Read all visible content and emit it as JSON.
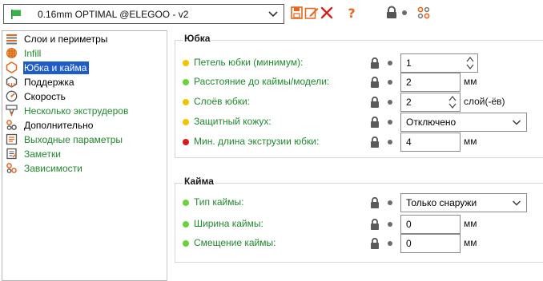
{
  "colors": {
    "accent_green": "#1f8a2c",
    "selection_blue": "#1e5cc8",
    "bullet_yellow": "#f2c400",
    "bullet_green": "#6ad33b",
    "bullet_red": "#d81b1b",
    "toolbar_orange": "#e8651a",
    "toolbar_red": "#d62020"
  },
  "preset": {
    "name": "0.16mm OPTIMAL @ELEGOO - v2",
    "flag_icon": "flag-icon",
    "chevron_icon": "chevron-down-icon"
  },
  "toolbar": {
    "icons": [
      "save-icon",
      "edit-icon",
      "delete-icon",
      "help-icon",
      "lock-icon",
      "dot",
      "compare-icon"
    ]
  },
  "sidebar": {
    "items": [
      {
        "label": "Слои и периметры",
        "icon": "layers-icon",
        "green": false,
        "selected": false
      },
      {
        "label": "Infill",
        "icon": "infill-icon",
        "green": true,
        "selected": false
      },
      {
        "label": "Юбка и кайма",
        "icon": "skirt-icon",
        "green": false,
        "selected": true
      },
      {
        "label": "Поддержка",
        "icon": "support-icon",
        "green": false,
        "selected": false
      },
      {
        "label": "Скорость",
        "icon": "speed-icon",
        "green": false,
        "selected": false
      },
      {
        "label": "Несколько экструдеров",
        "icon": "extruders-icon",
        "green": true,
        "selected": false
      },
      {
        "label": "Дополнительно",
        "icon": "advanced-icon",
        "green": false,
        "selected": false
      },
      {
        "label": "Выходные параметры",
        "icon": "output-icon",
        "green": true,
        "selected": false
      },
      {
        "label": "Заметки",
        "icon": "notes-icon",
        "green": true,
        "selected": false
      },
      {
        "label": "Зависимости",
        "icon": "dependencies-icon",
        "green": true,
        "selected": false
      }
    ]
  },
  "skirt": {
    "title": "Юбка",
    "options": [
      {
        "label": "Петель юбки (минимум):",
        "bullet": "yellow",
        "value": "1",
        "control": "spin",
        "unit": ""
      },
      {
        "label": "Расстояние до каймы/модели:",
        "bullet": "green",
        "value": "2",
        "control": "text",
        "unit": "мм"
      },
      {
        "label": "Слоёв юбки:",
        "bullet": "yellow",
        "value": "2",
        "control": "spin",
        "unit": "слой(-ёв)"
      },
      {
        "label": "Защитный кожух:",
        "bullet": "yellow",
        "value": "Отключено",
        "control": "select",
        "unit": ""
      },
      {
        "label": "Мин. длина экструзии юбки:",
        "bullet": "red",
        "value": "4",
        "control": "text",
        "unit": "мм"
      }
    ]
  },
  "brim": {
    "title": "Кайма",
    "options": [
      {
        "label": "Тип каймы:",
        "bullet": "green",
        "value": "Только снаружи",
        "control": "select",
        "unit": ""
      },
      {
        "label": "Ширина каймы:",
        "bullet": "green",
        "value": "0",
        "control": "text",
        "unit": "мм"
      },
      {
        "label": "Смещение каймы:",
        "bullet": "green",
        "value": "0",
        "control": "text",
        "unit": "мм"
      }
    ]
  }
}
